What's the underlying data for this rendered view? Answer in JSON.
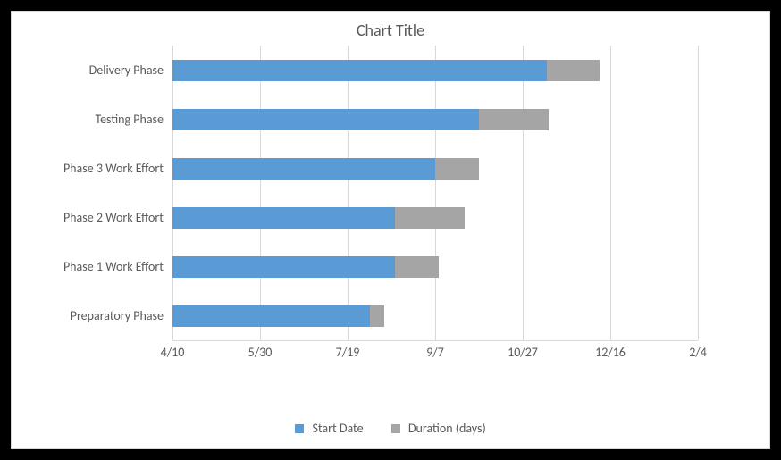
{
  "chart_data": {
    "type": "bar",
    "orientation": "horizontal",
    "stacked": true,
    "title": "Chart Title",
    "xlabel": "",
    "ylabel": "",
    "x_axis": {
      "ticks": [
        "4/10",
        "5/30",
        "7/19",
        "9/7",
        "10/27",
        "12/16",
        "2/4"
      ],
      "range_serial": [
        42835,
        43135
      ],
      "tick_serial": [
        42835,
        42885,
        42935,
        42985,
        43035,
        43085,
        43135
      ]
    },
    "categories": [
      "Preparatory Phase",
      "Phase 1 Work Effort",
      "Phase 2 Work Effort",
      "Phase 3 Work Effort",
      "Testing Phase",
      "Delivery Phase"
    ],
    "series": [
      {
        "name": "Start Date",
        "role": "offset",
        "color": "#5b9bd5",
        "dates": [
          "8/1",
          "8/15",
          "8/15",
          "9/7",
          "10/2",
          "11/10"
        ],
        "values_serial": [
          42948,
          42962,
          42962,
          42985,
          43010,
          43049
        ]
      },
      {
        "name": "Duration (days)",
        "role": "duration",
        "color": "#a5a5a5",
        "values": [
          8,
          25,
          40,
          25,
          40,
          30
        ]
      }
    ],
    "legend": {
      "position": "bottom"
    },
    "grid": {
      "x": true,
      "y": false
    }
  }
}
